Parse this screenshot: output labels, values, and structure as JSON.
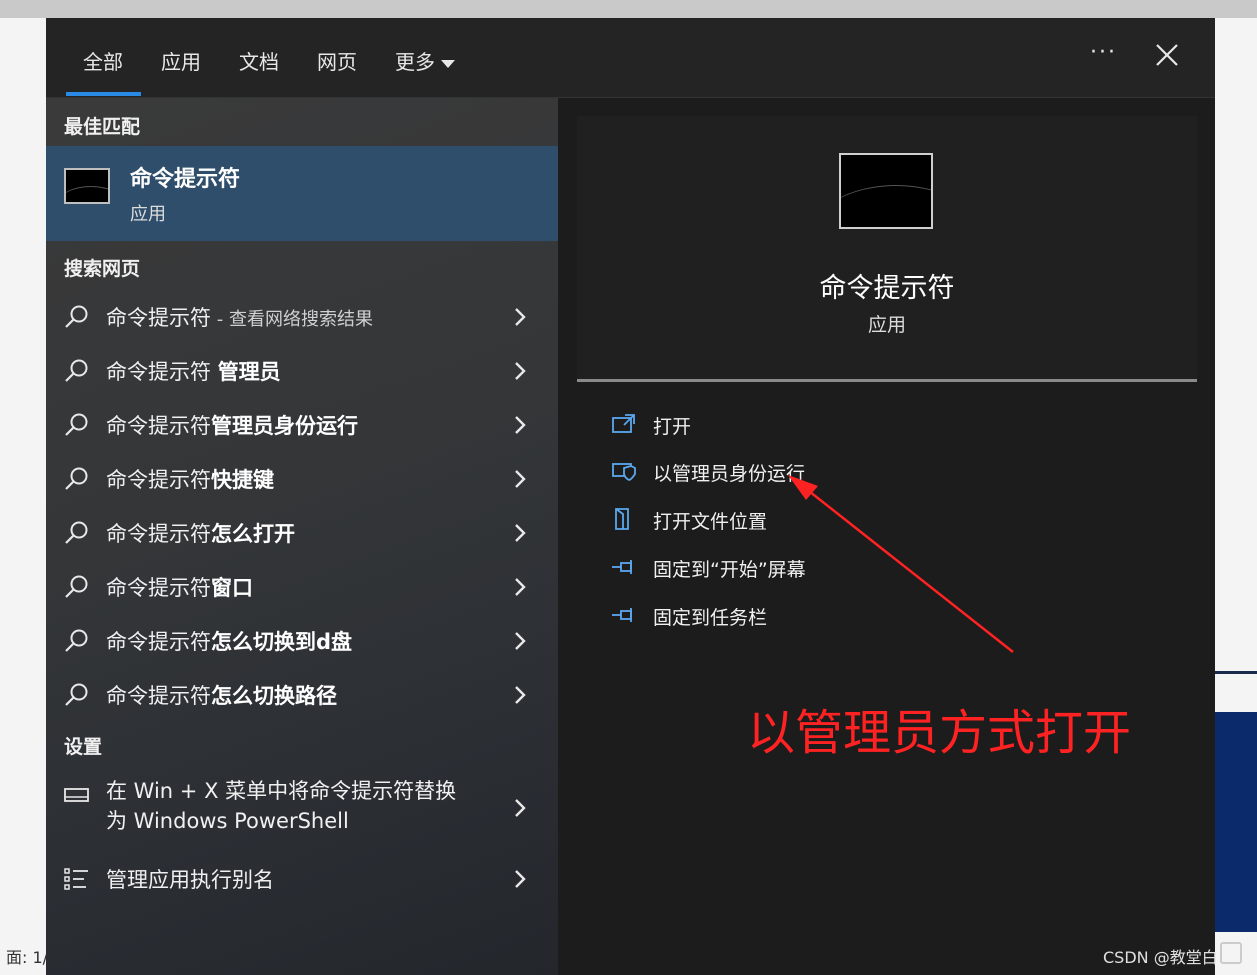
{
  "tabs": [
    {
      "label": "全部"
    },
    {
      "label": "应用"
    },
    {
      "label": "文档"
    },
    {
      "label": "网页"
    },
    {
      "label": "更多"
    }
  ],
  "sections": {
    "best_match": "最佳匹配",
    "search_web": "搜索网页",
    "settings": "设置"
  },
  "best_match": {
    "title": "命令提示符",
    "subtitle": "应用",
    "icon": "cmd-app-icon"
  },
  "web_results": [
    {
      "prefix": "命令提示符",
      "bold": "",
      "muted": " - 查看网络搜索结果"
    },
    {
      "prefix": "命令提示符 ",
      "bold": "管理员",
      "muted": ""
    },
    {
      "prefix": "命令提示符",
      "bold": "管理员身份运行",
      "muted": ""
    },
    {
      "prefix": "命令提示符",
      "bold": "快捷键",
      "muted": ""
    },
    {
      "prefix": "命令提示符",
      "bold": "怎么打开",
      "muted": ""
    },
    {
      "prefix": "命令提示符",
      "bold": "窗口",
      "muted": ""
    },
    {
      "prefix": "命令提示符",
      "bold": "怎么切换到d盘",
      "muted": ""
    },
    {
      "prefix": "命令提示符",
      "bold": "怎么切换路径",
      "muted": ""
    }
  ],
  "settings_results": [
    {
      "label": "在 Win + X 菜单中将命令提示符替换为 Windows PowerShell",
      "icon": "monitor-icon"
    },
    {
      "label": "管理应用执行别名",
      "icon": "list-icon"
    }
  ],
  "detail": {
    "title": "命令提示符",
    "subtitle": "应用"
  },
  "actions": [
    {
      "label": "打开",
      "icon": "open-icon"
    },
    {
      "label": "以管理员身份运行",
      "icon": "shield-icon"
    },
    {
      "label": "打开文件位置",
      "icon": "folder-icon"
    },
    {
      "label": "固定到“开始”屏幕",
      "icon": "pin-icon"
    },
    {
      "label": "固定到任务栏",
      "icon": "pin-icon"
    }
  ],
  "annotation": {
    "text": "以管理员方式打开",
    "color": "#ff2222"
  },
  "background": {
    "left_fragment": "面: 1/"
  },
  "watermark": "CSDN @教堂白",
  "colors": {
    "accent": "#2a8be6",
    "selected_bg": "#2f4e6b",
    "pane_bg": "#202020"
  }
}
